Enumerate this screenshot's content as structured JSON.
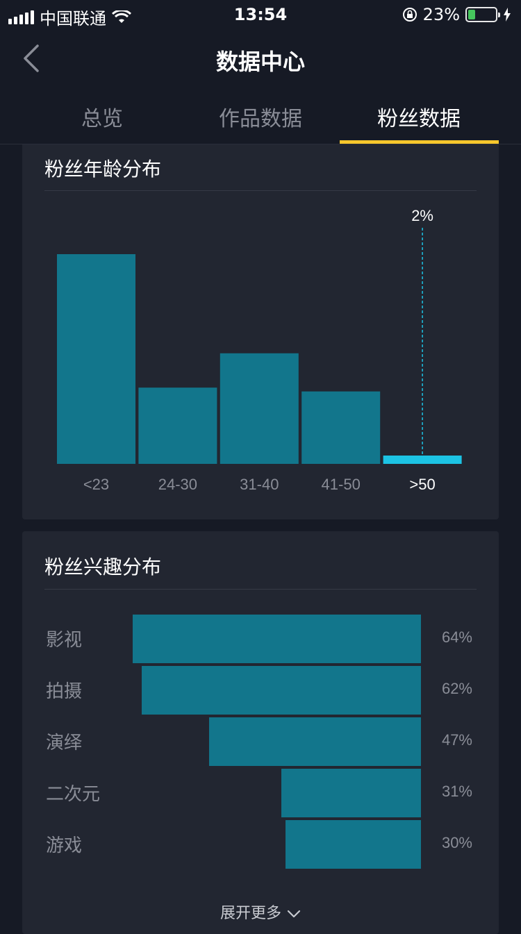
{
  "status_bar": {
    "carrier": "中国联通",
    "time": "13:54",
    "battery_text": "23%",
    "battery_level": 0.23
  },
  "nav": {
    "title": "数据中心"
  },
  "tabs": [
    {
      "label": "总览",
      "active": false
    },
    {
      "label": "作品数据",
      "active": false
    },
    {
      "label": "粉丝数据",
      "active": true
    }
  ],
  "age_section": {
    "title": "粉丝年龄分布"
  },
  "interest_section": {
    "title": "粉丝兴趣分布",
    "expand_label": "展开更多"
  },
  "colors": {
    "bar": "#12768c",
    "bar_highlight": "#1cc3e4",
    "tab_indicator": "#f7c72c",
    "card_bg": "#222631"
  },
  "chart_data": [
    {
      "type": "bar",
      "title": "粉丝年龄分布",
      "categories": [
        "<23",
        "24-30",
        "31-40",
        "41-50",
        ">50"
      ],
      "values": [
        55,
        20,
        29,
        19,
        2
      ],
      "highlight_index": 4,
      "highlight_label": "2%"
    },
    {
      "type": "bar",
      "orientation": "horizontal",
      "title": "粉丝兴趣分布",
      "categories": [
        "影视",
        "拍摄",
        "演绎",
        "二次元",
        "游戏"
      ],
      "values": [
        64,
        62,
        47,
        31,
        30
      ],
      "value_labels": [
        "64%",
        "62%",
        "47%",
        "31%",
        "30%"
      ]
    }
  ]
}
